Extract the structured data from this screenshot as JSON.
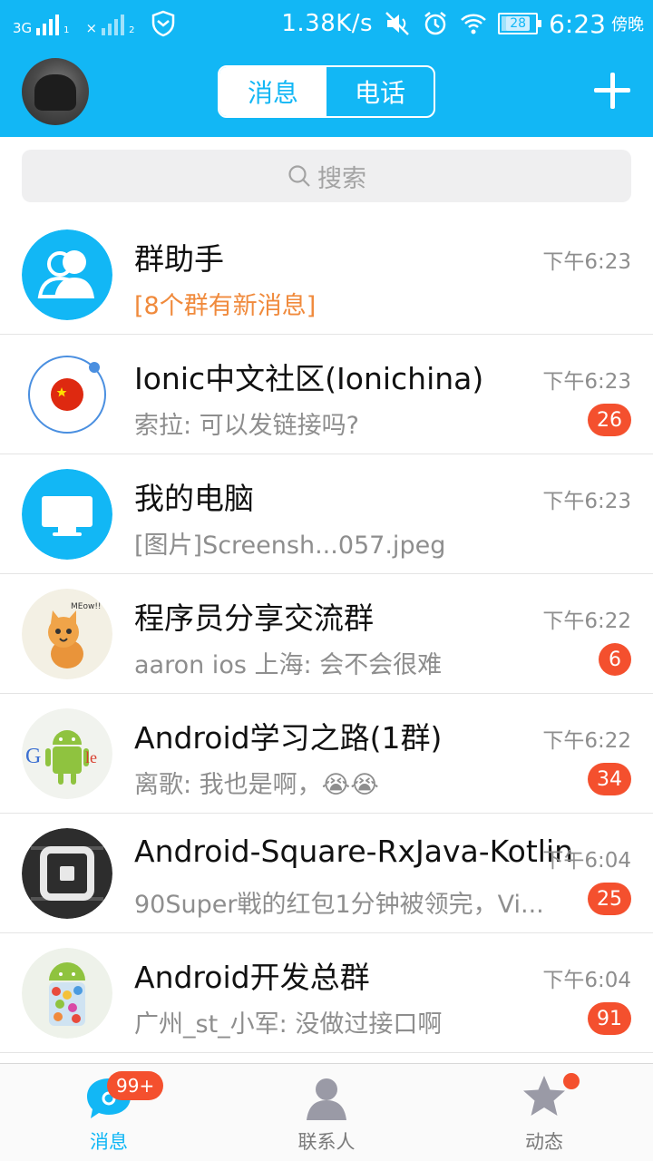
{
  "status_bar": {
    "network_1": "3G",
    "network_sub_1": "1",
    "network_2": "×",
    "network_sub_2": "2",
    "speed": "1.38K/s",
    "battery": "28",
    "time": "6:23",
    "period": "傍晚",
    "icons": [
      "shield-icon",
      "mute-icon",
      "alarm-icon",
      "wifi-icon",
      "battery-icon"
    ]
  },
  "header": {
    "tabs": [
      {
        "label": "消息",
        "active": true
      },
      {
        "label": "电话",
        "active": false
      }
    ],
    "add_icon": "plus-icon"
  },
  "search": {
    "placeholder": "搜索"
  },
  "conversations": [
    {
      "title": "群助手",
      "message": "[8个群有新消息]",
      "time": "下午6:23",
      "badge": "",
      "avatar": "group-assistant-icon"
    },
    {
      "title": "Ionic中文社区(Ionichina)",
      "message": "索拉: 可以发链接吗?",
      "time": "下午6:23",
      "badge": "26",
      "avatar": "ionic-logo"
    },
    {
      "title": "我的电脑",
      "message": "[图片]Screensh...057.jpeg",
      "time": "下午6:23",
      "badge": "",
      "avatar": "computer-icon"
    },
    {
      "title": "程序员分享交流群",
      "message": "aaron    ios   上海: 会不会很难",
      "time": "下午6:22",
      "badge": "6",
      "avatar": "cat-avatar"
    },
    {
      "title": "Android学习之路(1群)",
      "message": "离歌: 我也是啊，😭😭",
      "time": "下午6:22",
      "badge": "34",
      "avatar": "android-google-avatar"
    },
    {
      "title": "Android-Square-RxJava-Kotlin",
      "message": "90Super戦的红包1分钟被领完，Vi...",
      "time": "下午6:04",
      "badge": "25",
      "avatar": "square-logo-avatar"
    },
    {
      "title": "Android开发总群",
      "message": "广州_st_小军: 没做过接口啊",
      "time": "下午6:04",
      "badge": "91",
      "avatar": "android-jellybean-avatar"
    }
  ],
  "tabbar": {
    "items": [
      {
        "label": "消息",
        "badge": "99+",
        "icon": "message-bubble-icon",
        "active": true
      },
      {
        "label": "联系人",
        "icon": "contacts-icon",
        "active": false
      },
      {
        "label": "动态",
        "icon": "star-icon",
        "active": false
      }
    ]
  },
  "colors": {
    "brand_blue": "#12b7f5",
    "badge_red": "#f4502e",
    "notice_orange": "#f08a3c"
  }
}
